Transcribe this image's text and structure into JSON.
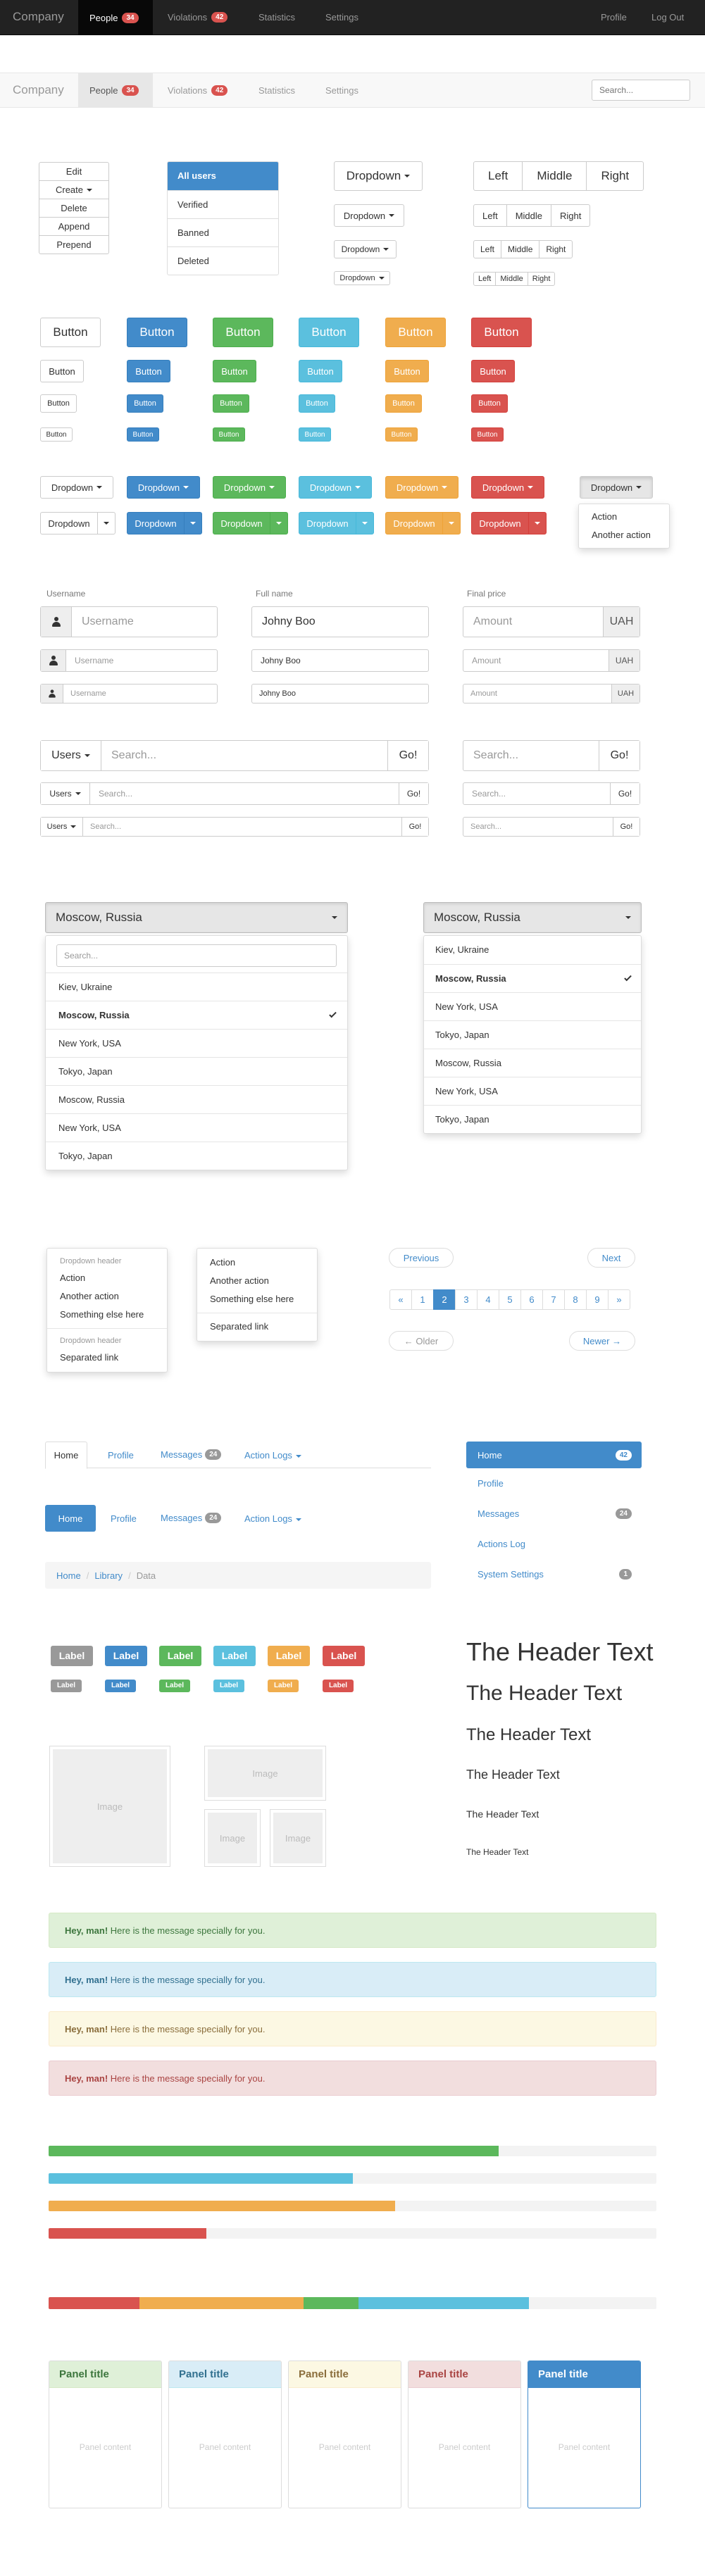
{
  "navbar": {
    "brand": "Company",
    "items": [
      {
        "label": "People",
        "badge": "34"
      },
      {
        "label": "Violations",
        "badge": "42"
      },
      {
        "label": "Statistics"
      },
      {
        "label": "Settings"
      }
    ],
    "right": [
      "Profile",
      "Log Out"
    ],
    "search_placeholder": "Search..."
  },
  "vbtn": [
    "Edit",
    "Create",
    "Delete",
    "Append",
    "Prepend"
  ],
  "listgroup": [
    "All users",
    "Verified",
    "Banned",
    "Deleted"
  ],
  "dropdown_label": "Dropdown",
  "segments": [
    "Left",
    "Middle",
    "Right"
  ],
  "button_label": "Button",
  "menu_small": [
    "Action",
    "Another action"
  ],
  "form": {
    "username_label": "Username",
    "fullname_label": "Full name",
    "price_label": "Final price",
    "username_ph": "Username",
    "fullname_value": "Johny Boo",
    "amount_ph": "Amount",
    "currency": "UAH"
  },
  "search": {
    "users": "Users",
    "placeholder": "Search...",
    "go": "Go!"
  },
  "city": {
    "selected": "Moscow, Russia",
    "search_ph": "Search...",
    "options": [
      "Kiev, Ukraine",
      "Moscow, Russia",
      "New York, USA",
      "Tokyo, Japan",
      "Moscow, Russia",
      "New York, USA",
      "Tokyo, Japan"
    ]
  },
  "menu_a": {
    "h1": "Dropdown header",
    "items1": [
      "Action",
      "Another action",
      "Something else here"
    ],
    "h2": "Dropdown header",
    "items2": [
      "Separated link"
    ]
  },
  "menu_b": {
    "items": [
      "Action",
      "Another action",
      "Something else here"
    ],
    "sep": "Separated link"
  },
  "pager": {
    "prev": "Previous",
    "next": "Next",
    "older": "← Older",
    "newer": "Newer →",
    "pages": [
      "«",
      "1",
      "2",
      "3",
      "4",
      "5",
      "6",
      "7",
      "8",
      "9",
      "»"
    ],
    "active": "2"
  },
  "tabs": [
    {
      "label": "Home"
    },
    {
      "label": "Profile"
    },
    {
      "label": "Messages",
      "badge": "24"
    },
    {
      "label": "Action Logs"
    }
  ],
  "breadcrumb": [
    "Home",
    "Library",
    "Data"
  ],
  "sidenav": [
    {
      "label": "Home",
      "badge": "42"
    },
    {
      "label": "Profile"
    },
    {
      "label": "Messages",
      "badge": "24"
    },
    {
      "label": "Actions Log"
    },
    {
      "label": "System Settings",
      "badge": "1"
    }
  ],
  "label_text": "Label",
  "header_text": "The Header Text",
  "image_text": "Image",
  "alerts": [
    {
      "strong": "Hey, man!",
      "text": " Here is the message specially for you."
    },
    {
      "strong": "Hey, man!",
      "text": " Here is the message specially for you."
    },
    {
      "strong": "Hey, man!",
      "text": " Here is the message specially for you."
    },
    {
      "strong": "Hey, man!",
      "text": " Here is the message specially for you."
    }
  ],
  "progress": [
    {
      "color": "#5cb85c",
      "pct": 74
    },
    {
      "color": "#5bc0de",
      "pct": 50
    },
    {
      "color": "#f0ad4e",
      "pct": 57
    },
    {
      "color": "#d9534f",
      "pct": 26
    }
  ],
  "stacked": [
    {
      "color": "#d9534f",
      "pct": 15
    },
    {
      "color": "#f0ad4e",
      "pct": 27
    },
    {
      "color": "#5cb85c",
      "pct": 9
    },
    {
      "color": "#5bc0de",
      "pct": 28
    }
  ],
  "panels": {
    "title": "Panel title",
    "content": "Panel content"
  },
  "colors": {
    "blue": "#428bca",
    "green": "#5cb85c",
    "cyan": "#5bc0de",
    "orange": "#f0ad4e",
    "red": "#d9534f",
    "gray": "#999999"
  }
}
